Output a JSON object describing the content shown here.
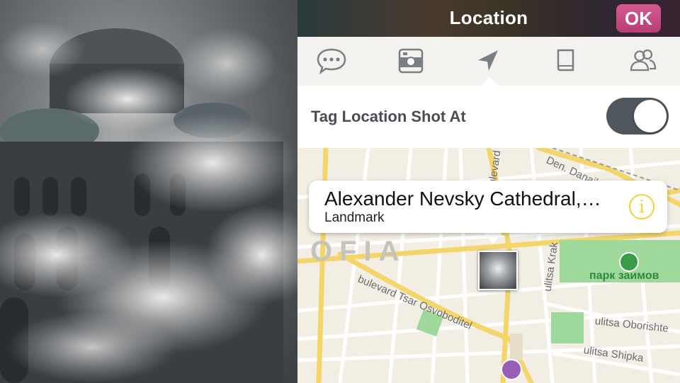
{
  "header": {
    "title": "Location",
    "ok_label": "OK"
  },
  "tabs": [
    {
      "name": "comment",
      "icon": "speech-bubble-icon"
    },
    {
      "name": "photo",
      "icon": "camera-icon"
    },
    {
      "name": "location",
      "icon": "location-arrow-icon",
      "selected": true
    },
    {
      "name": "notes",
      "icon": "notebook-icon"
    },
    {
      "name": "people",
      "icon": "people-icon"
    }
  ],
  "setting": {
    "label": "Tag Location Shot At",
    "toggle_on": true
  },
  "callout": {
    "title": "Alexander Nevsky Cathedral,…",
    "subtitle": "Landmark",
    "info_glyph": "i"
  },
  "map": {
    "city_label": "OFIA",
    "park_label": "парк заимов",
    "streets": [
      "bulevard Tsar Osvoboditel",
      "ulitsa Oborishte",
      "ulitsa Shipka",
      "ulitsa Krak",
      "Den. Danail N",
      "bulevard Va"
    ]
  },
  "colors": {
    "accent": "#c34c83",
    "toggle_track": "#4f565c",
    "park_green": "#3a9d47",
    "info_yellow": "#f0d33a"
  }
}
